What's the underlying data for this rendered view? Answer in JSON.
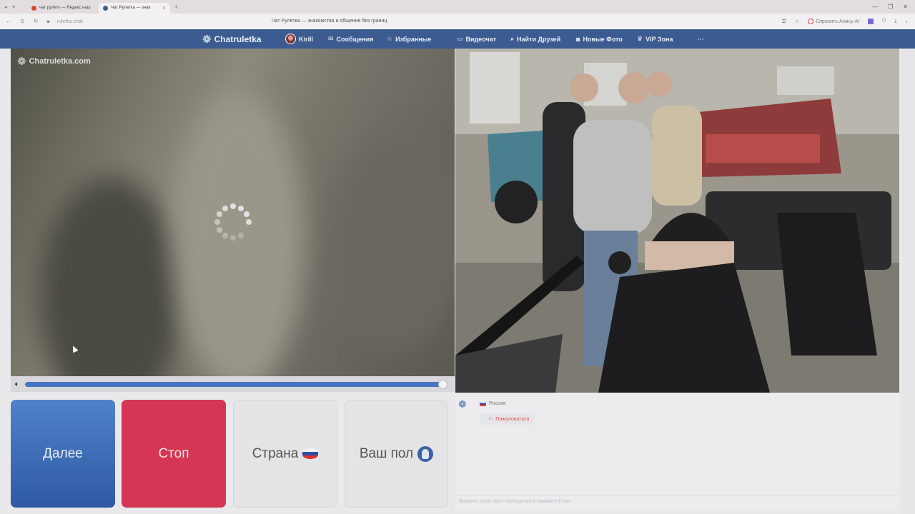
{
  "browser": {
    "tabs": [
      {
        "title": "чат рулетк — Яндекс наш",
        "favicon_color": "#e0453a"
      },
      {
        "title": "Чат Рулетка — знак",
        "favicon_color": "#3b5b91"
      }
    ],
    "new_tab": "+",
    "url": "ruletka.chat",
    "page_title": "Чат Рулетка — знакомства и общение без границ",
    "alice_label": "Спросить Алису AI",
    "window_controls": [
      "—",
      "❐",
      "✕"
    ]
  },
  "nav": {
    "brand": "Chatruletka",
    "user": "Kirill",
    "messages": "Сообщения",
    "favorites": "Избранные",
    "videochat": "Видеочат",
    "find_friends": "Найти Друзей",
    "new_photo": "Новые Фото",
    "vip": "VIP Зона",
    "more": "···"
  },
  "left_video": {
    "watermark": "Chatruletka.com",
    "volume_level": 1.0
  },
  "buttons": {
    "next": "Далее",
    "stop": "Стоп",
    "country": "Страна",
    "gender": "Ваш пол"
  },
  "chat": {
    "country": "Россия",
    "complain": "Пожаловаться",
    "input_placeholder": "Введите свой текст сообщения и нажмите Enter"
  },
  "colors": {
    "nav_bg": "#3b5b91",
    "next_button": "#3f6fb8",
    "stop_button": "#d43653",
    "progress": "#4775c0"
  }
}
